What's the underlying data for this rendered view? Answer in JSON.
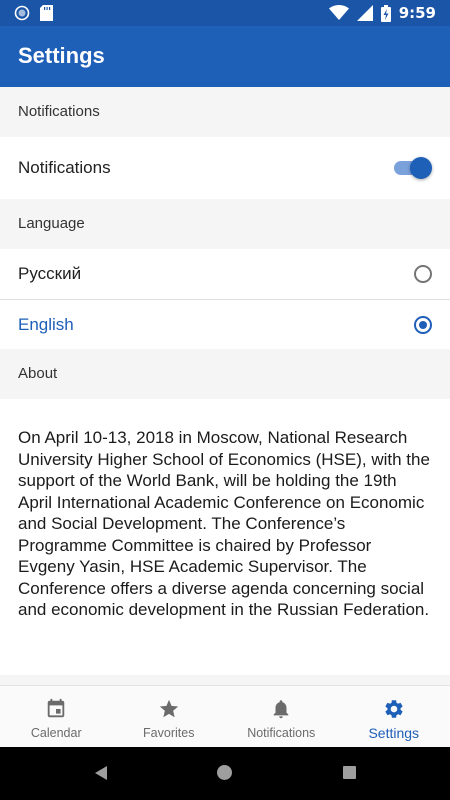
{
  "status_bar": {
    "time": "9:59"
  },
  "app_bar": {
    "title": "Settings"
  },
  "sections": {
    "notifications": {
      "header": "Notifications",
      "toggle_label": "Notifications",
      "toggle_on": true
    },
    "language": {
      "header": "Language",
      "options": [
        "Русский",
        "English"
      ],
      "selected": "English"
    },
    "about": {
      "header": "About",
      "text": "On April 10-13, 2018 in Moscow, National Research University Higher School of Economics (HSE), with the support of the World Bank, will be holding the 19th April International Academic Conference on Economic and Social Development. The Conference’s Programme Committee is chaired by Professor Evgeny Yasin, HSE Academic Supervisor. The Conference offers a diverse agenda concerning social and economic development in the Russian Federation."
    }
  },
  "bottom_nav": {
    "items": [
      {
        "label": "Calendar",
        "icon": "calendar-icon"
      },
      {
        "label": "Favorites",
        "icon": "star-icon"
      },
      {
        "label": "Notifications",
        "icon": "bell-icon"
      },
      {
        "label": "Settings",
        "icon": "gear-icon"
      }
    ],
    "active": "Settings"
  },
  "colors": {
    "primary": "#1e5fb8",
    "status_bar": "#1a55a8",
    "inactive": "#6b6b6b"
  }
}
